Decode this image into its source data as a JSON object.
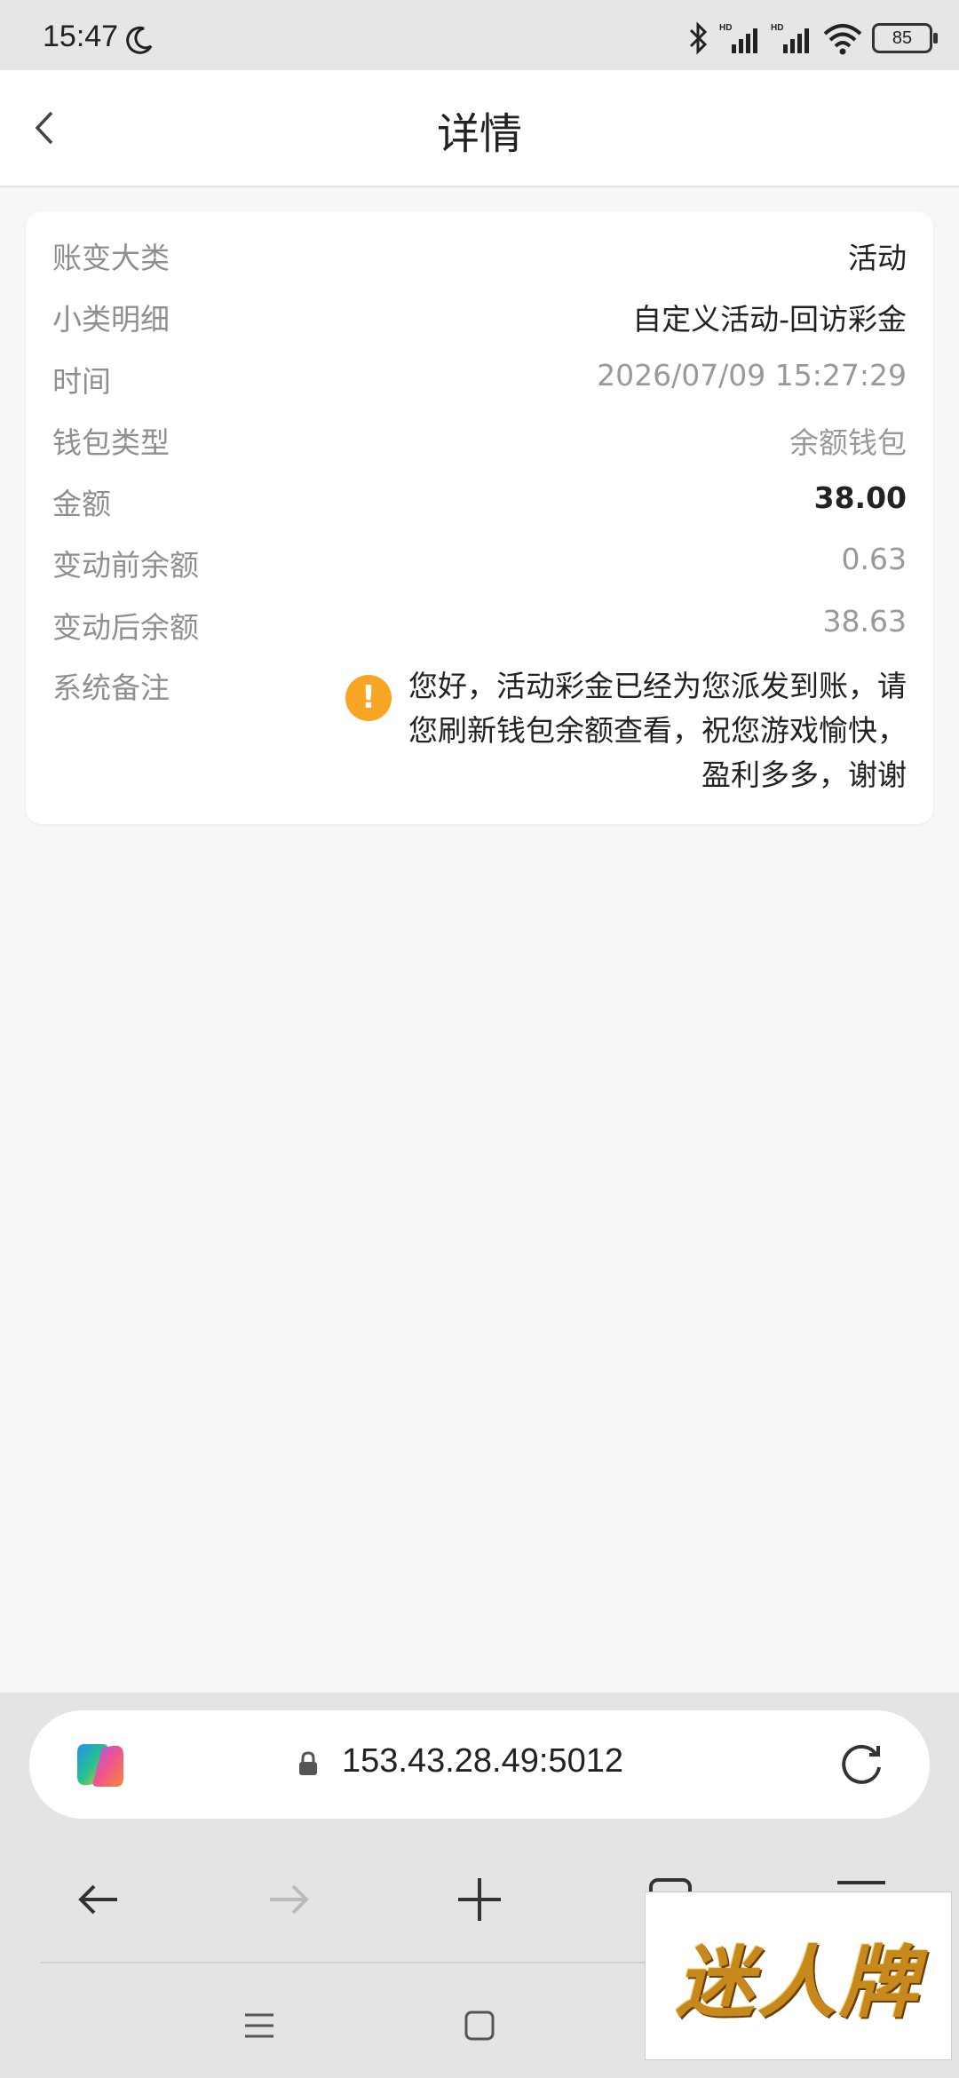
{
  "status_bar": {
    "time": "15:47",
    "battery": "85",
    "icons": [
      "moon-icon",
      "bluetooth-icon",
      "hd-signal-icon",
      "hd-signal-icon",
      "wifi-icon",
      "battery-icon"
    ]
  },
  "header": {
    "title": "详情"
  },
  "details": {
    "rows": [
      {
        "label": "账变大类",
        "value": "活动"
      },
      {
        "label": "小类明细",
        "value": "自定义活动-回访彩金"
      },
      {
        "label": "时间",
        "value": "2026/07/09 15:27:29"
      },
      {
        "label": "钱包类型",
        "value": "余额钱包"
      },
      {
        "label": "金额",
        "value": "38.00"
      },
      {
        "label": "变动前余额",
        "value": "0.63"
      },
      {
        "label": "变动后余额",
        "value": "38.63"
      }
    ],
    "note": {
      "label": "系统备注",
      "icon": "!",
      "lines": [
        "您好，活动彩金已经为您派发到账，请",
        "您刷新钱包余额查看，祝您游戏愉快，",
        "盈利多多，谢谢"
      ]
    }
  },
  "browser": {
    "url": "153.43.28.49:5012"
  },
  "watermark": {
    "text": "迷人牌"
  },
  "colors": {
    "warning": "#f6a623",
    "label": "#8f8f8f",
    "value_muted": "#999999"
  }
}
